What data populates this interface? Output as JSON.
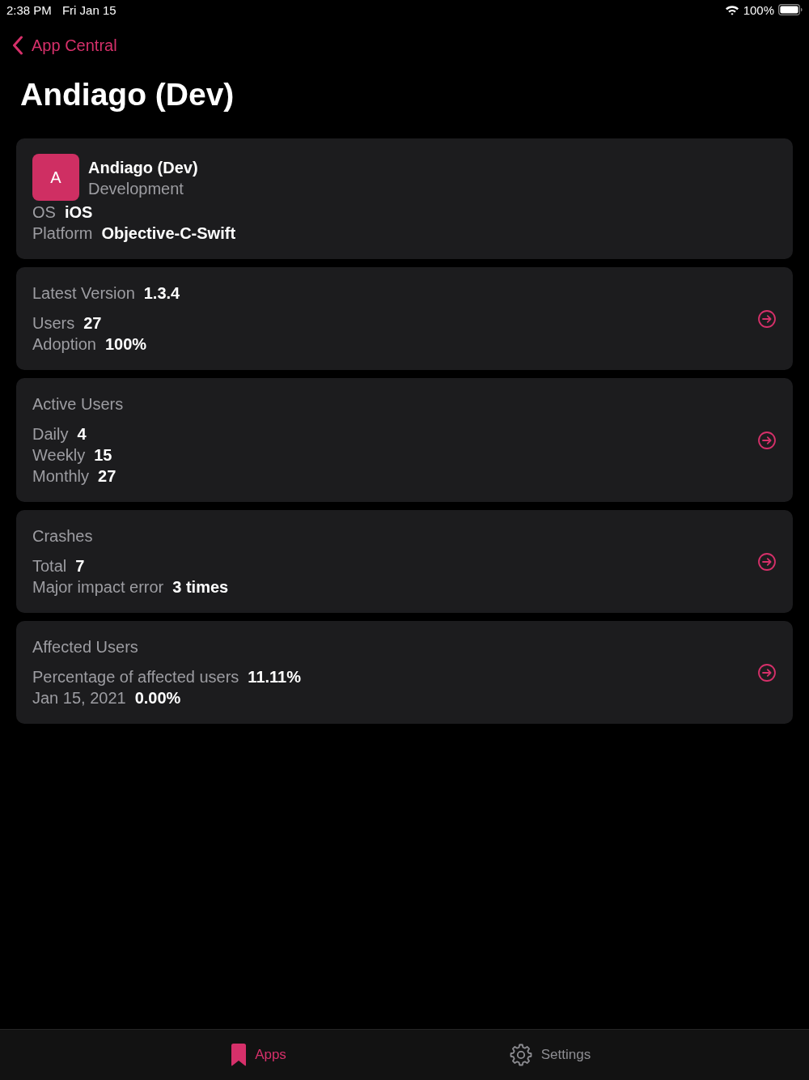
{
  "status_bar": {
    "time": "2:38 PM",
    "date": "Fri Jan 15",
    "battery": "100%"
  },
  "nav": {
    "back": "App Central",
    "title": "Andiago (Dev)"
  },
  "app_card": {
    "icon_letter": "A",
    "name": "Andiago (Dev)",
    "subtitle": "Development",
    "fields": [
      {
        "label": "OS",
        "value": "iOS"
      },
      {
        "label": "Platform",
        "value": "Objective-C-Swift"
      }
    ]
  },
  "sections": [
    {
      "heading": {
        "label": "Latest Version",
        "value": "1.3.4"
      },
      "rows": [
        {
          "label": "Users",
          "value": "27"
        },
        {
          "label": "Adoption",
          "value": "100%"
        }
      ]
    },
    {
      "heading": {
        "label": "Active Users"
      },
      "rows": [
        {
          "label": "Daily",
          "value": "4"
        },
        {
          "label": "Weekly",
          "value": "15"
        },
        {
          "label": "Monthly",
          "value": "27"
        }
      ]
    },
    {
      "heading": {
        "label": "Crashes"
      },
      "rows": [
        {
          "label": "Total",
          "value": "7"
        },
        {
          "label": "Major impact error",
          "value": "3 times"
        }
      ]
    },
    {
      "heading": {
        "label": "Affected Users"
      },
      "rows": [
        {
          "label": "Percentage of affected users",
          "value": "11.11%"
        },
        {
          "label": "Jan 15, 2021",
          "value": "0.00%"
        }
      ]
    }
  ],
  "tab_bar": {
    "tabs": [
      {
        "label": "Apps",
        "selected": true
      },
      {
        "label": "Settings",
        "selected": false
      }
    ]
  }
}
